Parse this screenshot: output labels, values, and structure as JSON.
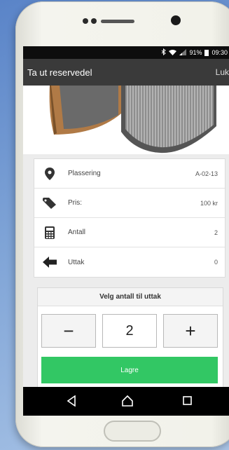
{
  "status_bar": {
    "battery": "91%",
    "time": "09:30"
  },
  "app_bar": {
    "title": "Ta ut reservedel",
    "close_label": "Lukk"
  },
  "info": [
    {
      "icon": "location-pin-icon",
      "label": "Plassering",
      "value": "A-02-13"
    },
    {
      "icon": "price-tag-icon",
      "label": "Pris:",
      "value": "100 kr"
    },
    {
      "icon": "calculator-icon",
      "label": "Antall",
      "value": "2"
    },
    {
      "icon": "arrow-left-icon",
      "label": "Uttak",
      "value": "0"
    }
  ],
  "quantity": {
    "header": "Velg antall til uttak",
    "minus": "−",
    "plus": "+",
    "value": "2",
    "save_label": "Lagre"
  }
}
